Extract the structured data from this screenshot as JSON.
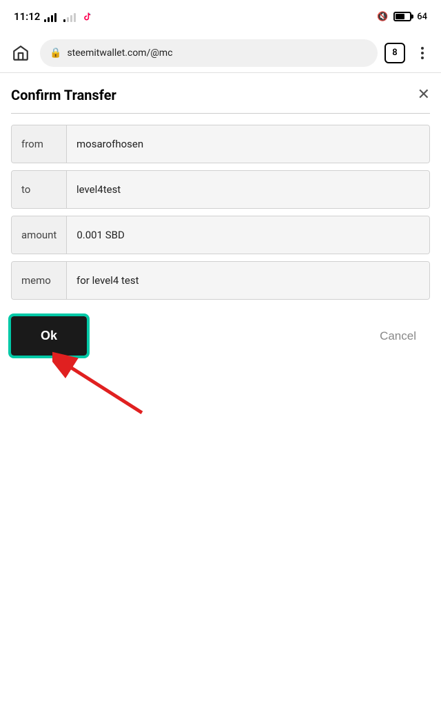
{
  "statusBar": {
    "time": "11:12",
    "battery": "64"
  },
  "browserBar": {
    "url": "steemitwallet.com/@mc",
    "tabCount": "8"
  },
  "dialog": {
    "title": "Confirm Transfer",
    "fields": {
      "from": {
        "label": "from",
        "value": "mosarofhosen"
      },
      "to": {
        "label": "to",
        "value": "level4test"
      },
      "amount": {
        "label": "amount",
        "value": "0.001 SBD"
      },
      "memo": {
        "label": "memo",
        "value": "for level4 test"
      }
    },
    "okButton": "Ok",
    "cancelButton": "Cancel"
  }
}
